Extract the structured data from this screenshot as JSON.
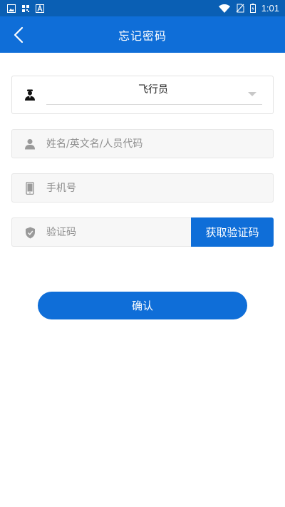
{
  "status_bar": {
    "time": "1:01",
    "left_icons": [
      "image-icon",
      "qr-icon",
      "a-icon"
    ],
    "right_icons": [
      "wifi-icon",
      "no-sim-icon",
      "battery-icon"
    ]
  },
  "app_bar": {
    "title": "忘记密码",
    "back_icon": "chevron-left-icon"
  },
  "form": {
    "role_select": {
      "value": "飞行员",
      "icon": "pilot-icon"
    },
    "name_field": {
      "placeholder": "姓名/英文名/人员代码",
      "value": "",
      "icon": "person-icon"
    },
    "phone_field": {
      "placeholder": "手机号",
      "value": "",
      "icon": "phone-icon"
    },
    "code_field": {
      "placeholder": "验证码",
      "value": "",
      "icon": "shield-icon"
    },
    "get_code_label": "获取验证码",
    "confirm_label": "确认"
  },
  "colors": {
    "primary": "#0f6ed8",
    "status_bar": "#0a5fb4",
    "field_bg": "#f7f7f7",
    "icon_gray": "#9a9a9a"
  }
}
